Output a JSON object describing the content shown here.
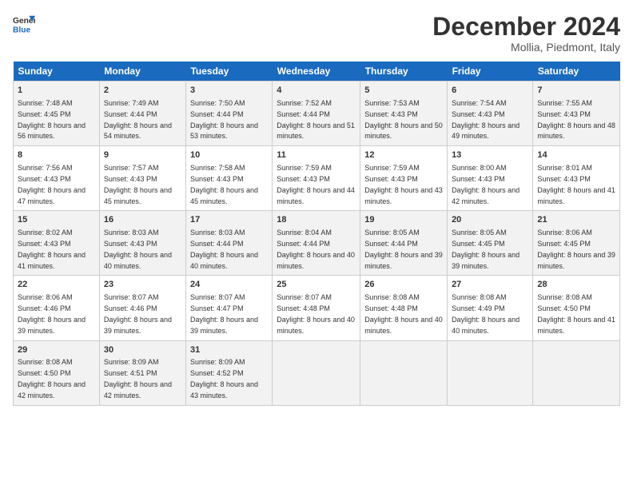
{
  "header": {
    "logo_line1": "General",
    "logo_line2": "Blue",
    "title": "December 2024",
    "location": "Mollia, Piedmont, Italy"
  },
  "weekdays": [
    "Sunday",
    "Monday",
    "Tuesday",
    "Wednesday",
    "Thursday",
    "Friday",
    "Saturday"
  ],
  "weeks": [
    [
      {
        "day": "1",
        "sunrise": "Sunrise: 7:48 AM",
        "sunset": "Sunset: 4:45 PM",
        "daylight": "Daylight: 8 hours and 56 minutes."
      },
      {
        "day": "2",
        "sunrise": "Sunrise: 7:49 AM",
        "sunset": "Sunset: 4:44 PM",
        "daylight": "Daylight: 8 hours and 54 minutes."
      },
      {
        "day": "3",
        "sunrise": "Sunrise: 7:50 AM",
        "sunset": "Sunset: 4:44 PM",
        "daylight": "Daylight: 8 hours and 53 minutes."
      },
      {
        "day": "4",
        "sunrise": "Sunrise: 7:52 AM",
        "sunset": "Sunset: 4:44 PM",
        "daylight": "Daylight: 8 hours and 51 minutes."
      },
      {
        "day": "5",
        "sunrise": "Sunrise: 7:53 AM",
        "sunset": "Sunset: 4:43 PM",
        "daylight": "Daylight: 8 hours and 50 minutes."
      },
      {
        "day": "6",
        "sunrise": "Sunrise: 7:54 AM",
        "sunset": "Sunset: 4:43 PM",
        "daylight": "Daylight: 8 hours and 49 minutes."
      },
      {
        "day": "7",
        "sunrise": "Sunrise: 7:55 AM",
        "sunset": "Sunset: 4:43 PM",
        "daylight": "Daylight: 8 hours and 48 minutes."
      }
    ],
    [
      {
        "day": "8",
        "sunrise": "Sunrise: 7:56 AM",
        "sunset": "Sunset: 4:43 PM",
        "daylight": "Daylight: 8 hours and 47 minutes."
      },
      {
        "day": "9",
        "sunrise": "Sunrise: 7:57 AM",
        "sunset": "Sunset: 4:43 PM",
        "daylight": "Daylight: 8 hours and 45 minutes."
      },
      {
        "day": "10",
        "sunrise": "Sunrise: 7:58 AM",
        "sunset": "Sunset: 4:43 PM",
        "daylight": "Daylight: 8 hours and 45 minutes."
      },
      {
        "day": "11",
        "sunrise": "Sunrise: 7:59 AM",
        "sunset": "Sunset: 4:43 PM",
        "daylight": "Daylight: 8 hours and 44 minutes."
      },
      {
        "day": "12",
        "sunrise": "Sunrise: 7:59 AM",
        "sunset": "Sunset: 4:43 PM",
        "daylight": "Daylight: 8 hours and 43 minutes."
      },
      {
        "day": "13",
        "sunrise": "Sunrise: 8:00 AM",
        "sunset": "Sunset: 4:43 PM",
        "daylight": "Daylight: 8 hours and 42 minutes."
      },
      {
        "day": "14",
        "sunrise": "Sunrise: 8:01 AM",
        "sunset": "Sunset: 4:43 PM",
        "daylight": "Daylight: 8 hours and 41 minutes."
      }
    ],
    [
      {
        "day": "15",
        "sunrise": "Sunrise: 8:02 AM",
        "sunset": "Sunset: 4:43 PM",
        "daylight": "Daylight: 8 hours and 41 minutes."
      },
      {
        "day": "16",
        "sunrise": "Sunrise: 8:03 AM",
        "sunset": "Sunset: 4:43 PM",
        "daylight": "Daylight: 8 hours and 40 minutes."
      },
      {
        "day": "17",
        "sunrise": "Sunrise: 8:03 AM",
        "sunset": "Sunset: 4:44 PM",
        "daylight": "Daylight: 8 hours and 40 minutes."
      },
      {
        "day": "18",
        "sunrise": "Sunrise: 8:04 AM",
        "sunset": "Sunset: 4:44 PM",
        "daylight": "Daylight: 8 hours and 40 minutes."
      },
      {
        "day": "19",
        "sunrise": "Sunrise: 8:05 AM",
        "sunset": "Sunset: 4:44 PM",
        "daylight": "Daylight: 8 hours and 39 minutes."
      },
      {
        "day": "20",
        "sunrise": "Sunrise: 8:05 AM",
        "sunset": "Sunset: 4:45 PM",
        "daylight": "Daylight: 8 hours and 39 minutes."
      },
      {
        "day": "21",
        "sunrise": "Sunrise: 8:06 AM",
        "sunset": "Sunset: 4:45 PM",
        "daylight": "Daylight: 8 hours and 39 minutes."
      }
    ],
    [
      {
        "day": "22",
        "sunrise": "Sunrise: 8:06 AM",
        "sunset": "Sunset: 4:46 PM",
        "daylight": "Daylight: 8 hours and 39 minutes."
      },
      {
        "day": "23",
        "sunrise": "Sunrise: 8:07 AM",
        "sunset": "Sunset: 4:46 PM",
        "daylight": "Daylight: 8 hours and 39 minutes."
      },
      {
        "day": "24",
        "sunrise": "Sunrise: 8:07 AM",
        "sunset": "Sunset: 4:47 PM",
        "daylight": "Daylight: 8 hours and 39 minutes."
      },
      {
        "day": "25",
        "sunrise": "Sunrise: 8:07 AM",
        "sunset": "Sunset: 4:48 PM",
        "daylight": "Daylight: 8 hours and 40 minutes."
      },
      {
        "day": "26",
        "sunrise": "Sunrise: 8:08 AM",
        "sunset": "Sunset: 4:48 PM",
        "daylight": "Daylight: 8 hours and 40 minutes."
      },
      {
        "day": "27",
        "sunrise": "Sunrise: 8:08 AM",
        "sunset": "Sunset: 4:49 PM",
        "daylight": "Daylight: 8 hours and 40 minutes."
      },
      {
        "day": "28",
        "sunrise": "Sunrise: 8:08 AM",
        "sunset": "Sunset: 4:50 PM",
        "daylight": "Daylight: 8 hours and 41 minutes."
      }
    ],
    [
      {
        "day": "29",
        "sunrise": "Sunrise: 8:08 AM",
        "sunset": "Sunset: 4:50 PM",
        "daylight": "Daylight: 8 hours and 42 minutes."
      },
      {
        "day": "30",
        "sunrise": "Sunrise: 8:09 AM",
        "sunset": "Sunset: 4:51 PM",
        "daylight": "Daylight: 8 hours and 42 minutes."
      },
      {
        "day": "31",
        "sunrise": "Sunrise: 8:09 AM",
        "sunset": "Sunset: 4:52 PM",
        "daylight": "Daylight: 8 hours and 43 minutes."
      },
      null,
      null,
      null,
      null
    ]
  ]
}
